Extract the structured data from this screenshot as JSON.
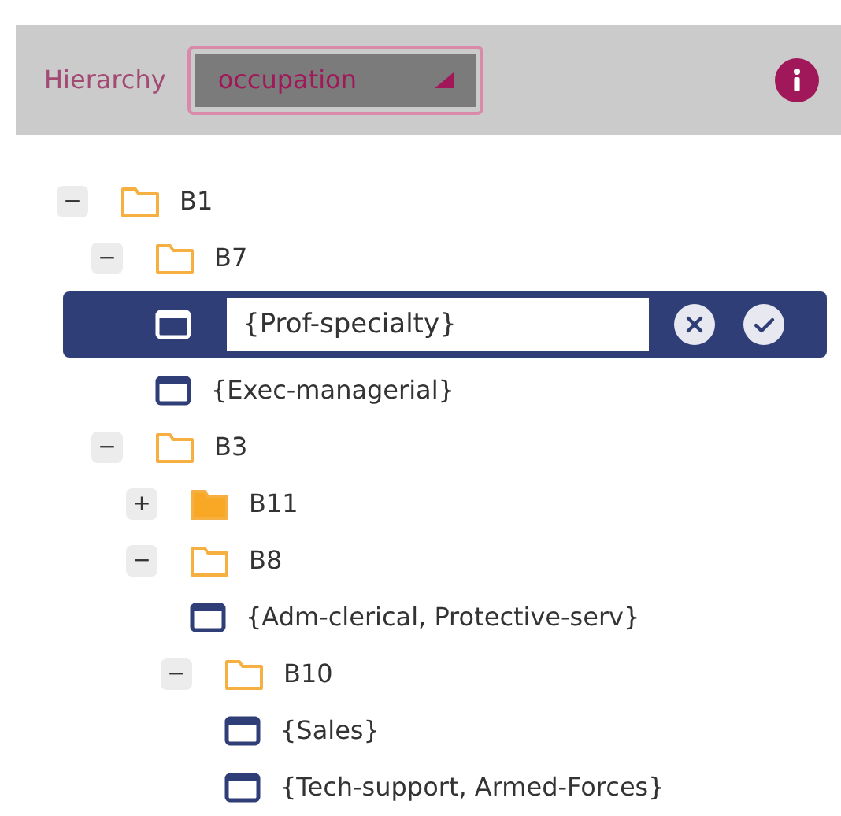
{
  "header": {
    "label": "Hierarchy",
    "dropdown": {
      "value": "occupation"
    }
  },
  "tree": [
    {
      "kind": "folder",
      "label": "B1",
      "toggle": "−",
      "expanded": true,
      "children": [
        {
          "kind": "folder",
          "label": "B7",
          "toggle": "−",
          "expanded": true,
          "children": [
            {
              "kind": "leaf",
              "label": "{Prof-specialty}",
              "selected": true
            },
            {
              "kind": "leaf",
              "label": "{Exec-managerial}",
              "selected": false
            }
          ]
        },
        {
          "kind": "folder",
          "label": "B3",
          "toggle": "−",
          "expanded": true,
          "children": [
            {
              "kind": "folder",
              "label": "B11",
              "toggle": "+",
              "expanded": false
            },
            {
              "kind": "folder",
              "label": "B8",
              "toggle": "−",
              "expanded": true,
              "children": [
                {
                  "kind": "leaf",
                  "label": "{Adm-clerical, Protective-serv}",
                  "selected": false
                },
                {
                  "kind": "folder",
                  "label": "B10",
                  "toggle": "−",
                  "expanded": true,
                  "children": [
                    {
                      "kind": "leaf",
                      "label": "{Sales}",
                      "selected": false
                    },
                    {
                      "kind": "leaf",
                      "label": "{Tech-support, Armed-Forces}",
                      "selected": false
                    }
                  ]
                }
              ]
            }
          ]
        }
      ]
    }
  ]
}
